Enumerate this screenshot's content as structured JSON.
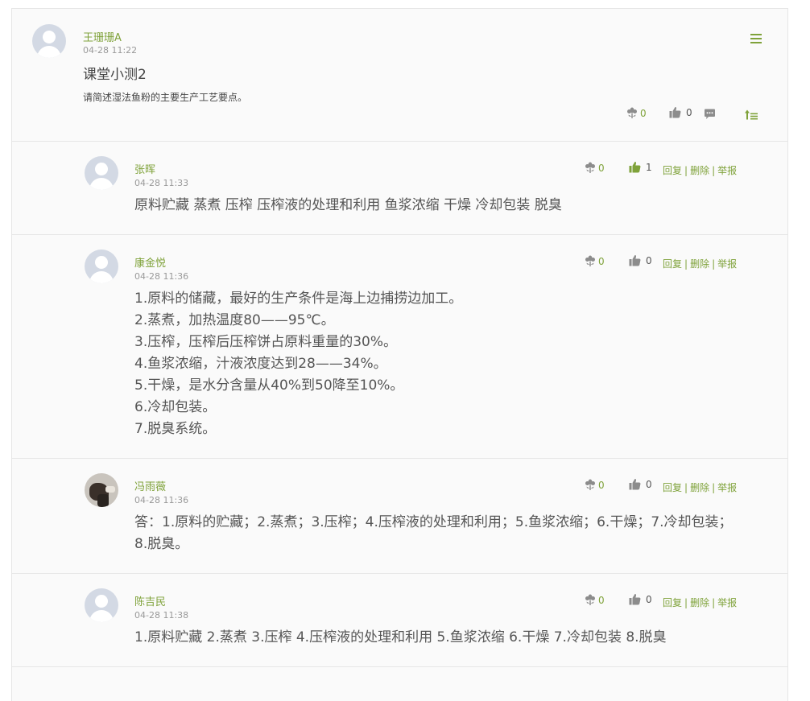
{
  "post": {
    "author": "王珊珊A",
    "time": "04-28 11:22",
    "title": "课堂小测2",
    "description": "请简述湿法鱼粉的主要生产工艺要点。",
    "flower_count": "0",
    "like_count": "0"
  },
  "replies": [
    {
      "author": "张晖",
      "time": "04-28 11:33",
      "flowers": "0",
      "likes": "1",
      "liked": true,
      "lines": [
        "原料贮藏 蒸煮 压榨 压榨液的处理和利用 鱼浆浓缩 干燥 冷却包装 脱臭"
      ]
    },
    {
      "author": "康金悦",
      "time": "04-28 11:36",
      "flowers": "0",
      "likes": "0",
      "liked": false,
      "lines": [
        "1.原料的储藏，最好的生产条件是海上边捕捞边加工。",
        "2.蒸煮，加热温度80——95℃。",
        "3.压榨，压榨后压榨饼占原料重量的30%。",
        "4.鱼浆浓缩，汁液浓度达到28——34%。",
        "5.干燥，是水分含量从40%到50降至10%。",
        "6.冷却包装。",
        "7.脱臭系统。"
      ]
    },
    {
      "author": "冯雨薇",
      "time": "04-28 11:36",
      "flowers": "0",
      "likes": "0",
      "liked": false,
      "lines": [
        "答：1.原料的贮藏；2.蒸煮；3.压榨；4.压榨液的处理和利用；5.鱼浆浓缩；6.干燥；7.冷却包装；",
        "8.脱臭。"
      ]
    },
    {
      "author": "陈吉民",
      "time": "04-28 11:38",
      "flowers": "0",
      "likes": "0",
      "liked": false,
      "lines": [
        "1.原料贮藏 2.蒸煮 3.压榨 4.压榨液的处理和利用 5.鱼浆浓缩 6.干燥 7.冷却包装 8.脱臭"
      ]
    }
  ],
  "reply_actions": {
    "reply": "回复",
    "delete": "删除",
    "report": "举报"
  },
  "icons": {
    "flower": "flower-icon",
    "thumb": "thumbs-up-icon",
    "comment": "comment-icon",
    "top": "sort-top-icon",
    "menu": "menu-icon"
  },
  "colors": {
    "accent": "#7fa23a",
    "gray_icon": "#8c8c8c"
  }
}
